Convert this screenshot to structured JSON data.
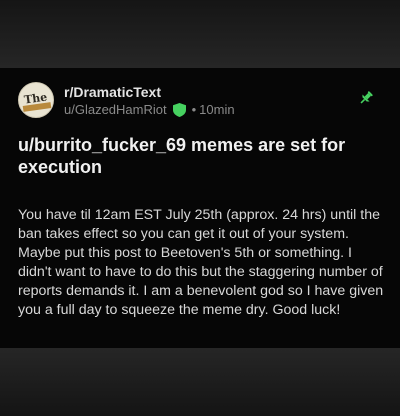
{
  "post": {
    "subreddit": "r/DramaticText",
    "author": "u/GlazedHamRiot",
    "separator": "•",
    "time": "10min",
    "avatar_text": "The",
    "title": "u/burrito_fucker_69 memes are set for execution",
    "body": "You have til 12am EST July 25th (approx. 24 hrs) until the ban takes effect so you can get it out of your system. Maybe put this post to Beetoven's 5th or something. I didn't want to have to do this but the staggering number of reports demands it. I am a benevolent god so I have given you a full day to squeeze the meme dry. Good luck!",
    "pinned": true,
    "mod_badge": "shield-icon",
    "pin_icon": "pin-icon"
  },
  "colors": {
    "card_bg": "#060606",
    "outer_bg": "#1c1c1c",
    "mod_green": "#46d160",
    "pin_green": "#46d160",
    "title_text": "#f0f0f0",
    "body_text": "#d8d8d8",
    "meta_text": "#8a8a8a"
  }
}
